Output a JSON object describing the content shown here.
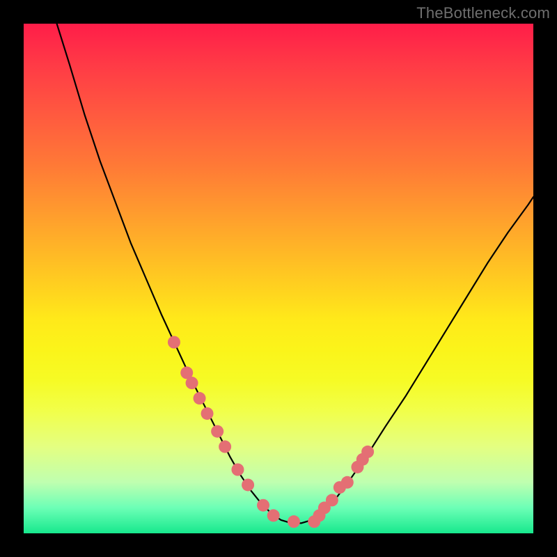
{
  "watermark": "TheBottleneck.com",
  "colors": {
    "curve_stroke": "#000000",
    "marker_fill": "#e46f74",
    "marker_stroke": "#d96369"
  },
  "chart_data": {
    "type": "line",
    "title": "",
    "xlabel": "",
    "ylabel": "",
    "xlim": [
      0,
      100
    ],
    "ylim": [
      0,
      100
    ],
    "grid": false,
    "legend": "none",
    "series": [
      {
        "name": "bottleneck-curve",
        "x": [
          6.5,
          9,
          12,
          15,
          18,
          21,
          24,
          27,
          30,
          33,
          36,
          38.5,
          40.5,
          42.5,
          44.5,
          46.5,
          48.5,
          50.5,
          52.5,
          54.5,
          56.5,
          58.5,
          61,
          64,
          67.5,
          71,
          75,
          79,
          83,
          87,
          91,
          95,
          99,
          100
        ],
        "y": [
          100,
          92,
          82,
          73,
          65,
          57,
          50,
          43,
          36.5,
          30,
          24,
          19,
          15,
          11.5,
          8.5,
          6,
          4,
          2.6,
          2,
          2,
          2.6,
          4,
          6.5,
          10.5,
          15.5,
          21,
          27,
          33.5,
          40,
          46.5,
          53,
          59,
          64.5,
          66
        ]
      }
    ],
    "markers": {
      "name": "highlight-points",
      "x": [
        29.5,
        32,
        33,
        34.5,
        36,
        38,
        39.5,
        42,
        44,
        47,
        49,
        53,
        57,
        58,
        59,
        60.5,
        62,
        63.5,
        65.5,
        66.5,
        67.5
      ],
      "y": [
        37.5,
        31.5,
        29.5,
        26.5,
        23.5,
        20,
        17,
        12.5,
        9.5,
        5.5,
        3.5,
        2.3,
        2.3,
        3.5,
        5,
        6.5,
        9,
        10,
        13,
        14.5,
        16
      ]
    }
  }
}
